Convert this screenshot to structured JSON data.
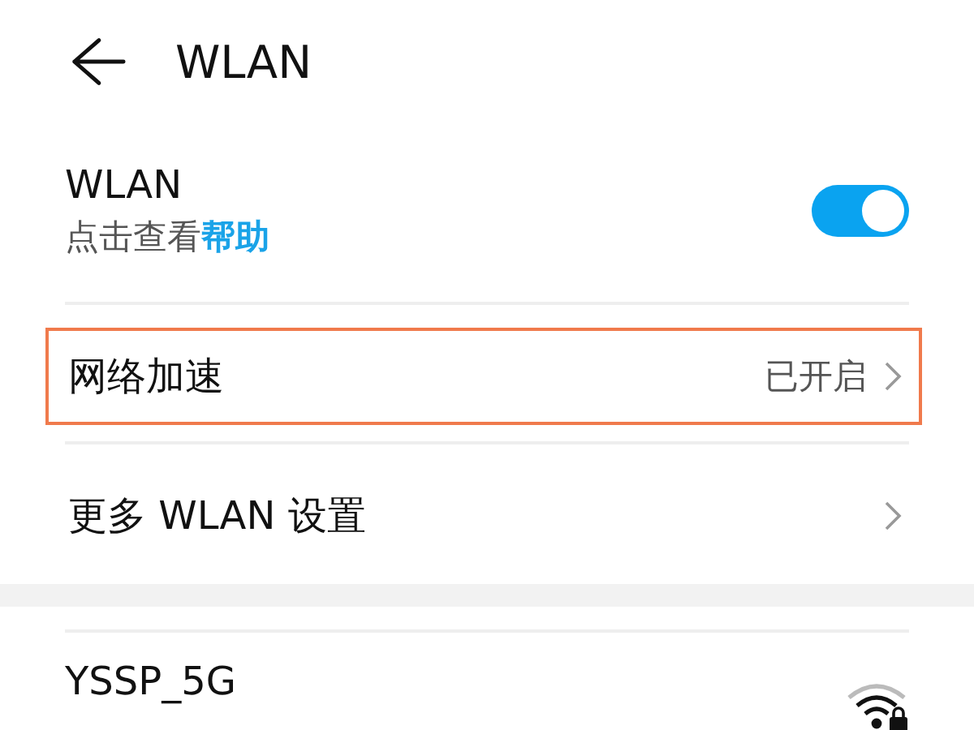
{
  "header": {
    "title": "WLAN"
  },
  "wlan": {
    "label": "WLAN",
    "hint": "点击查看",
    "help_link": "帮助",
    "on": true
  },
  "settings": [
    {
      "label": "网络加速",
      "value": "已开启",
      "highlighted": true
    },
    {
      "label": "更多 WLAN 设置",
      "highlighted": false
    }
  ],
  "networks": [
    {
      "name": "YSSP_5G",
      "locked": true
    }
  ]
}
